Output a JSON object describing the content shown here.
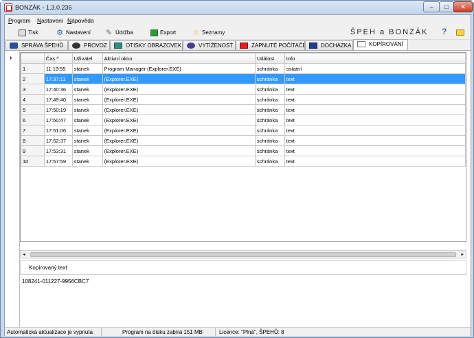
{
  "window": {
    "title": "BONZÁK - 1.3.0.236"
  },
  "menu": [
    "Program",
    "Nastavení",
    "Nápověda"
  ],
  "toolbar": {
    "print": "Tisk",
    "settings": "Nastavení",
    "maintenance": "Údržba",
    "export": "Export",
    "lists": "Seznamy",
    "brand": "ŠPEH a BONZÁK"
  },
  "tabs": [
    {
      "label": "SPRÁVA ŠPEHŮ",
      "icon": "spy-icon"
    },
    {
      "label": "PROVOZ",
      "icon": "operation-icon"
    },
    {
      "label": "OTISKY OBRAZOVEK",
      "icon": "screenshot-icon"
    },
    {
      "label": "VYTÍŽENOST",
      "icon": "load-icon"
    },
    {
      "label": "ZAPNUTÉ POČÍTAČE",
      "icon": "monitor-icon"
    },
    {
      "label": "DOCHÁZKA",
      "icon": "calendar-icon"
    },
    {
      "label": "KOPÍROVÁNÍ",
      "icon": "copy-icon",
      "active": true
    }
  ],
  "grid": {
    "headers": [
      "",
      "Čas ^",
      "Uživatel",
      "Aktivní okno",
      "Událost",
      "Info"
    ],
    "rows": [
      [
        "1",
        "11:19:55",
        "stanek",
        "Program Manager (Explorer.EXE)",
        "schránka",
        "ostatní"
      ],
      [
        "2",
        "17:37:11",
        "stanek",
        "(Explorer.EXE)",
        "schránka",
        "text"
      ],
      [
        "3",
        "17:40:36",
        "stanek",
        "(Explorer.EXE)",
        "schránka",
        "text"
      ],
      [
        "4",
        "17:49:40",
        "stanek",
        "(Explorer.EXE)",
        "schránka",
        "text"
      ],
      [
        "5",
        "17:50:19",
        "stanek",
        "(Explorer.EXE)",
        "schránka",
        "text"
      ],
      [
        "6",
        "17:50:47",
        "stanek",
        "(Explorer.EXE)",
        "schránka",
        "text"
      ],
      [
        "7",
        "17:51:06",
        "stanek",
        "(Explorer.EXE)",
        "schránka",
        "text"
      ],
      [
        "8",
        "17:52:37",
        "stanek",
        "(Explorer.EXE)",
        "schránka",
        "text"
      ],
      [
        "9",
        "17:53:31",
        "stanek",
        "(Explorer.EXE)",
        "schránka",
        "text"
      ],
      [
        "10",
        "17:57:59",
        "stanek",
        "(Explorer.EXE)",
        "schránka",
        "text"
      ]
    ],
    "selected_row": 1
  },
  "copied": {
    "label": "Kopírovaný text",
    "value": "108241-011227-9956CBC7"
  },
  "status": {
    "updates": "Automatická aktualizace je vypnuta",
    "disk": "Program na disku zabírá 151 MB",
    "license": "Licence: \"Plná\", ŠPEHŮ: 8"
  },
  "colors": {
    "selection": "#3399ff",
    "brand_accent": "#2c5aa0"
  }
}
